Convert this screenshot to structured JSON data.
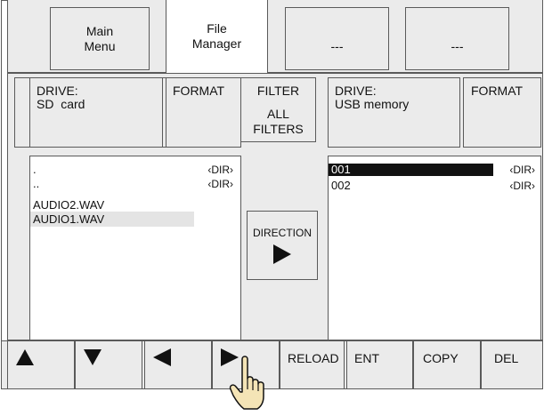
{
  "tabs": [
    {
      "line1": "Main",
      "line2": "Menu"
    },
    {
      "line1": "File",
      "line2": "Manager"
    },
    {
      "line1": "---"
    },
    {
      "line1": "---"
    }
  ],
  "left_drive": {
    "label": "DRIVE:",
    "name": "SD  card",
    "format_label": "FORMAT"
  },
  "filter": {
    "label": "FILTER",
    "value_line1": "ALL",
    "value_line2": "FILTERS"
  },
  "right_drive": {
    "label": "DRIVE:",
    "name": "USB memory",
    "format_label": "FORMAT"
  },
  "left_files": [
    {
      "name": ".",
      "tag": "‹DIR›"
    },
    {
      "name": "..",
      "tag": "‹DIR›"
    },
    {
      "name": "AUDIO2.WAV",
      "tag": ""
    },
    {
      "name": "AUDIO1.WAV",
      "tag": ""
    }
  ],
  "right_files": [
    {
      "name": "001",
      "tag": "‹DIR›"
    },
    {
      "name": "002",
      "tag": "‹DIR›"
    }
  ],
  "direction": {
    "label": "DIRECTION",
    "icon": "triangle-right-icon"
  },
  "bottom_buttons": {
    "up_icon": "triangle-up-icon",
    "down_icon": "triangle-down-icon",
    "left_icon": "triangle-left-icon",
    "right_icon": "triangle-right-icon",
    "reload": "RELOAD",
    "ent": "ENT",
    "copy": "COPY",
    "del": "DEL"
  },
  "cursor": {
    "icon": "hand-pointer-icon"
  }
}
